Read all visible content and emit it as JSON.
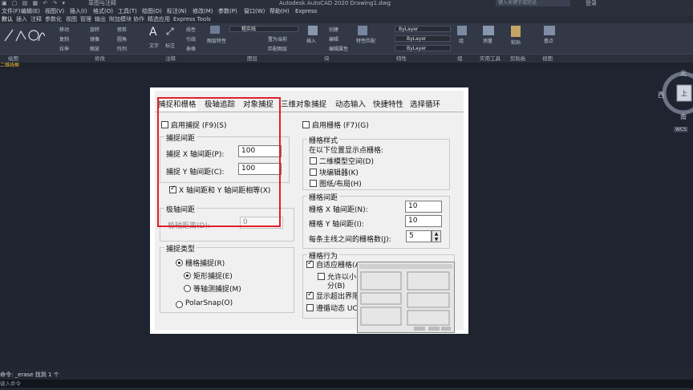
{
  "titlebar": {
    "app_title": "Autodesk AutoCAD 2020   Drawing1.dwg",
    "workspace": "草图与注释",
    "search_placeholder": "键入关键字或短语",
    "login": "登录"
  },
  "menubar": {
    "items": [
      "文件(F)",
      "编辑(E)",
      "视图(V)",
      "插入(I)",
      "格式(O)",
      "工具(T)",
      "绘图(D)",
      "标注(N)",
      "修改(M)",
      "参数(P)",
      "窗口(W)",
      "帮助(H)",
      "Express"
    ]
  },
  "ribbon": {
    "tabs": [
      "默认",
      "插入",
      "注释",
      "参数化",
      "视图",
      "管理",
      "输出",
      "附加模块",
      "协作",
      "精选应用",
      "Express Tools"
    ],
    "active_tab": "默认",
    "panels": [
      "绘图",
      "修改",
      "注释",
      "图层",
      "块",
      "特性",
      "组",
      "实用工具",
      "剪贴板",
      "视图"
    ],
    "modify_buttons": [
      "移动",
      "旋转",
      "修剪",
      "复制",
      "镜像",
      "圆角",
      "拉伸",
      "缩放",
      "阵列"
    ],
    "annot_buttons": [
      "文字",
      "标注",
      "线性",
      "引线",
      "表格"
    ],
    "layer_button": "图层特性",
    "layer_current": "粗实线",
    "layer_buttons": [
      "置为当前",
      "匹配图层"
    ],
    "block_buttons": [
      "插入",
      "创建",
      "编辑",
      "编辑属性"
    ],
    "prop_button": "特性匹配",
    "prop_values": [
      "ByLayer",
      "ByLayer",
      "ByLayer"
    ],
    "group_button": "组",
    "util_button": "测量",
    "clip_button": "粘贴",
    "base_button": "基点"
  },
  "file_tab": "二维线框",
  "viewcube": {
    "north": "北",
    "south": "南",
    "west": "西",
    "top": "上",
    "wcs": "WCS"
  },
  "dialog": {
    "tabs": [
      "捕捉和栅格",
      "极轴追踪",
      "对象捕捉",
      "三维对象捕捉",
      "动态输入",
      "快捷特性",
      "选择循环"
    ],
    "snap_on": "启用捕捉 (F9)(S)",
    "snap_spacing_title": "捕捉间距",
    "snap_x_label": "捕捉 X 轴间距(P):",
    "snap_x_value": "100",
    "snap_y_label": "捕捉 Y 轴间距(C):",
    "snap_y_value": "100",
    "equal_xy": "X 轴间距和 Y 轴间距相等(X)",
    "polar_spacing_title": "极轴间距",
    "polar_distance_label": "极轴距离(D):",
    "polar_distance_value": "0",
    "snap_type_title": "捕捉类型",
    "grid_snap": "栅格捕捉(R)",
    "rect_snap": "矩形捕捉(E)",
    "iso_snap": "等轴测捕捉(M)",
    "polar_snap": "PolarSnap(O)",
    "grid_on": "启用栅格 (F7)(G)",
    "grid_style_title": "栅格样式",
    "grid_style_desc": "在以下位置显示点栅格:",
    "grid_style_2d": "二维模型空间(D)",
    "grid_style_block": "块编辑器(K)",
    "grid_style_sheet": "图纸/布局(H)",
    "grid_spacing_title": "栅格间距",
    "grid_x_label": "栅格 X 轴间距(N):",
    "grid_x_value": "10",
    "grid_y_label": "栅格 Y 轴间距(I):",
    "grid_y_value": "10",
    "major_label": "每条主线之间的栅格数(J):",
    "major_value": "5",
    "grid_behavior_title": "栅格行为",
    "adaptive": "自适应栅格(A)",
    "allow_sub_a": "允许以小于栅",
    "allow_sub_b": "分(B)",
    "beyond_limits": "显示超出界限的",
    "follow_ucs": "遵循动态 UCS(U)"
  },
  "command": {
    "history": "命令: _erase 找到 1 个",
    "prompt": "键入命令"
  }
}
